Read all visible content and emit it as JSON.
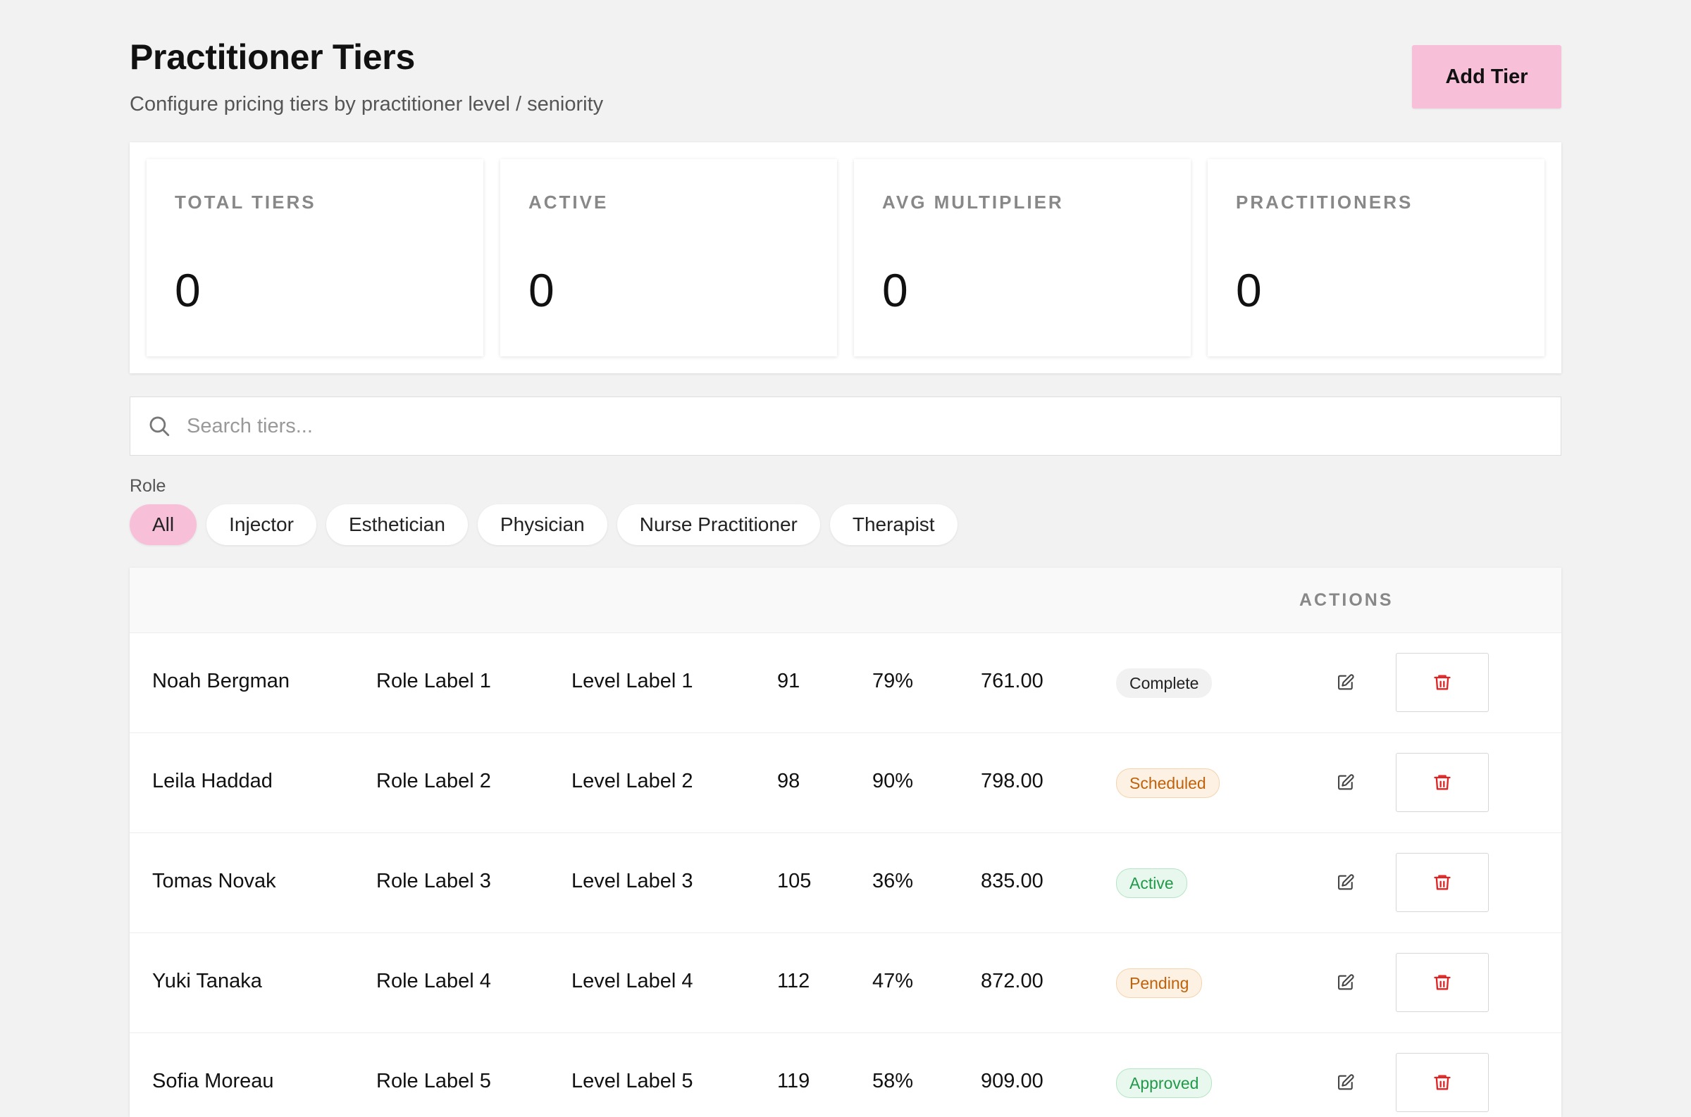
{
  "header": {
    "title": "Practitioner Tiers",
    "subtitle": "Configure pricing tiers by practitioner level / seniority",
    "add_label": "Add Tier"
  },
  "stats": [
    {
      "label": "TOTAL TIERS",
      "value": "0"
    },
    {
      "label": "ACTIVE",
      "value": "0"
    },
    {
      "label": "AVG MULTIPLIER",
      "value": "0"
    },
    {
      "label": "PRACTITIONERS",
      "value": "0"
    }
  ],
  "search": {
    "placeholder": "Search tiers...",
    "icon": "search-icon"
  },
  "filters": {
    "label": "Role",
    "selected": "All",
    "chips": [
      "All",
      "Injector",
      "Esthetician",
      "Physician",
      "Nurse Practitioner",
      "Therapist"
    ]
  },
  "table": {
    "actions_header": "ACTIONS",
    "rows": [
      {
        "name": "Noah Bergman",
        "role": "Role Label 1",
        "level": "Level Label 1",
        "count": "91",
        "pct": "79%",
        "price": "761.00",
        "status": "Complete"
      },
      {
        "name": "Leila Haddad",
        "role": "Role Label 2",
        "level": "Level Label 2",
        "count": "98",
        "pct": "90%",
        "price": "798.00",
        "status": "Scheduled"
      },
      {
        "name": "Tomas Novak",
        "role": "Role Label 3",
        "level": "Level Label 3",
        "count": "105",
        "pct": "36%",
        "price": "835.00",
        "status": "Active"
      },
      {
        "name": "Yuki Tanaka",
        "role": "Role Label 4",
        "level": "Level Label 4",
        "count": "112",
        "pct": "47%",
        "price": "872.00",
        "status": "Pending"
      },
      {
        "name": "Sofia Moreau",
        "role": "Role Label 5",
        "level": "Level Label 5",
        "count": "119",
        "pct": "58%",
        "price": "909.00",
        "status": "Approved"
      }
    ]
  },
  "colors": {
    "accent": "#f7c0d8",
    "delete": "#e02424",
    "status_complete": "#222222",
    "status_scheduled": "#c0620a",
    "status_active": "#22994a",
    "status_pending": "#c0620a",
    "status_approved": "#22994a"
  }
}
